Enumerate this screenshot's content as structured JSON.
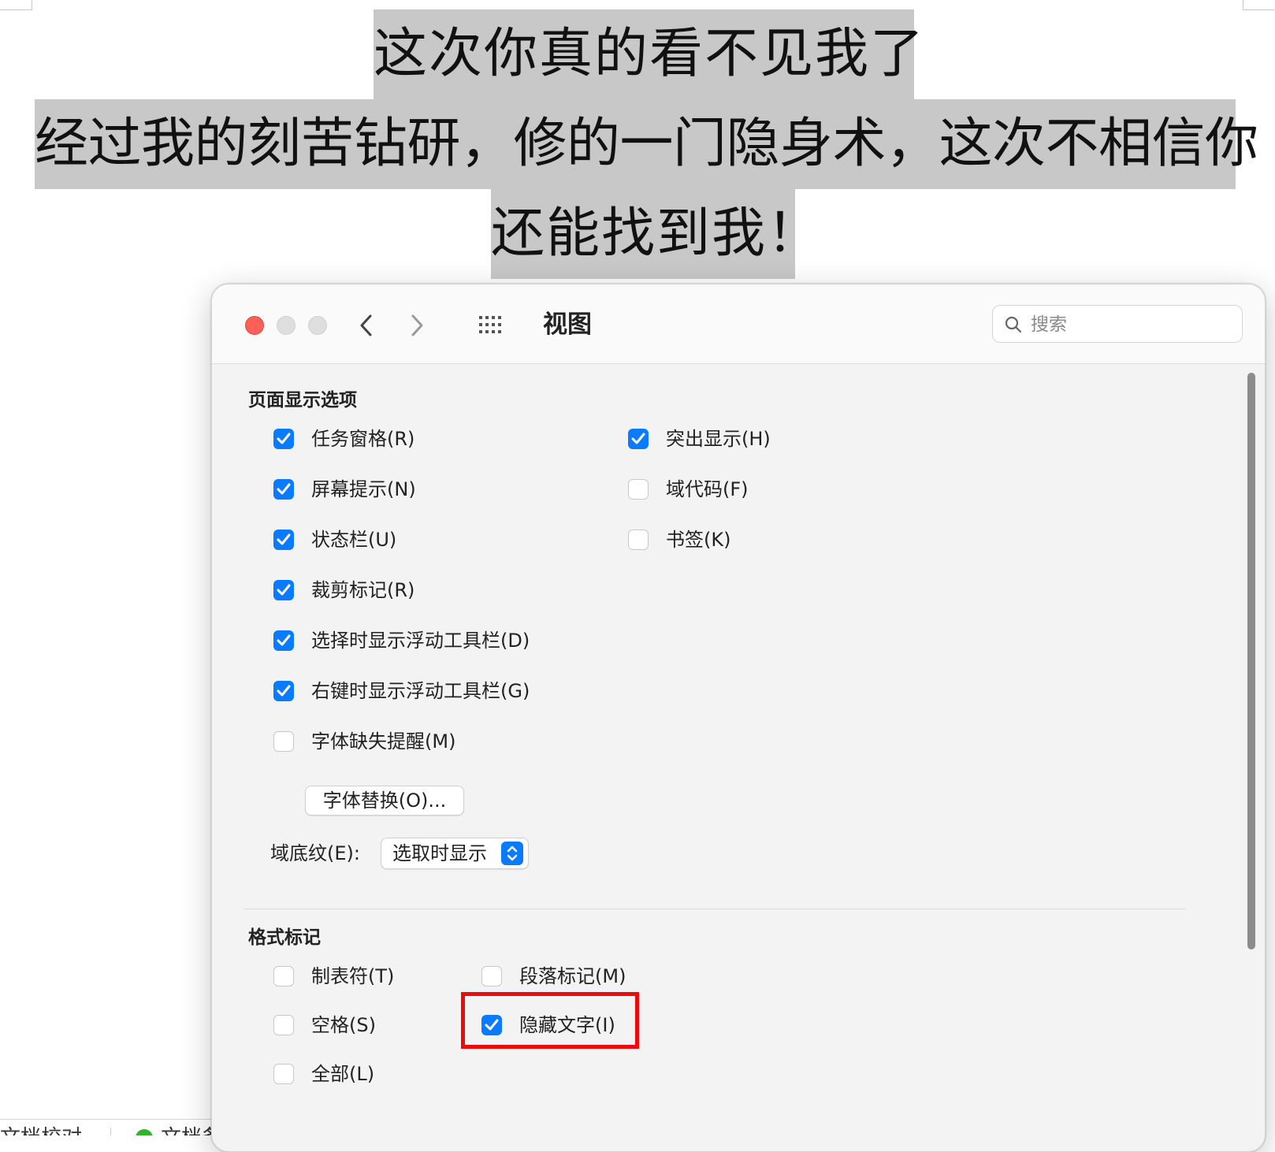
{
  "document": {
    "lines": [
      "这次你真的看不见我了",
      "经过我的刻苦钻研，修的一门隐身术，这次不相信你",
      "还能找到我！"
    ],
    "status_items": [
      "文档校对",
      "文档备"
    ]
  },
  "window": {
    "title": "视图",
    "search_placeholder": "搜索",
    "sections": {
      "page_display": {
        "title": "页面显示选项",
        "left_options": [
          {
            "label": "任务窗格(R)",
            "checked": true
          },
          {
            "label": "屏幕提示(N)",
            "checked": true
          },
          {
            "label": "状态栏(U)",
            "checked": true
          },
          {
            "label": "裁剪标记(R)",
            "checked": true
          },
          {
            "label": "选择时显示浮动工具栏(D)",
            "checked": true
          },
          {
            "label": "右键时显示浮动工具栏(G)",
            "checked": true
          },
          {
            "label": "字体缺失提醒(M)",
            "checked": false
          }
        ],
        "right_options": [
          {
            "label": "突出显示(H)",
            "checked": true
          },
          {
            "label": "域代码(F)",
            "checked": false
          },
          {
            "label": "书签(K)",
            "checked": false
          }
        ],
        "font_replace_button": "字体替换(O)...",
        "field_shading_label": "域底纹(E):",
        "field_shading_value": "选取时显示"
      },
      "format_marks": {
        "title": "格式标记",
        "left_options": [
          {
            "label": "制表符(T)",
            "checked": false
          },
          {
            "label": "空格(S)",
            "checked": false
          },
          {
            "label": "全部(L)",
            "checked": false
          }
        ],
        "right_options": [
          {
            "label": "段落标记(M)",
            "checked": false
          },
          {
            "label": "隐藏文字(I)",
            "checked": true
          }
        ]
      }
    }
  },
  "colors": {
    "accent": "#0a7bff",
    "highlight_box": "#ee0a0a",
    "text_selection": "#c8c8c8",
    "close_button": "#fe5f57"
  }
}
